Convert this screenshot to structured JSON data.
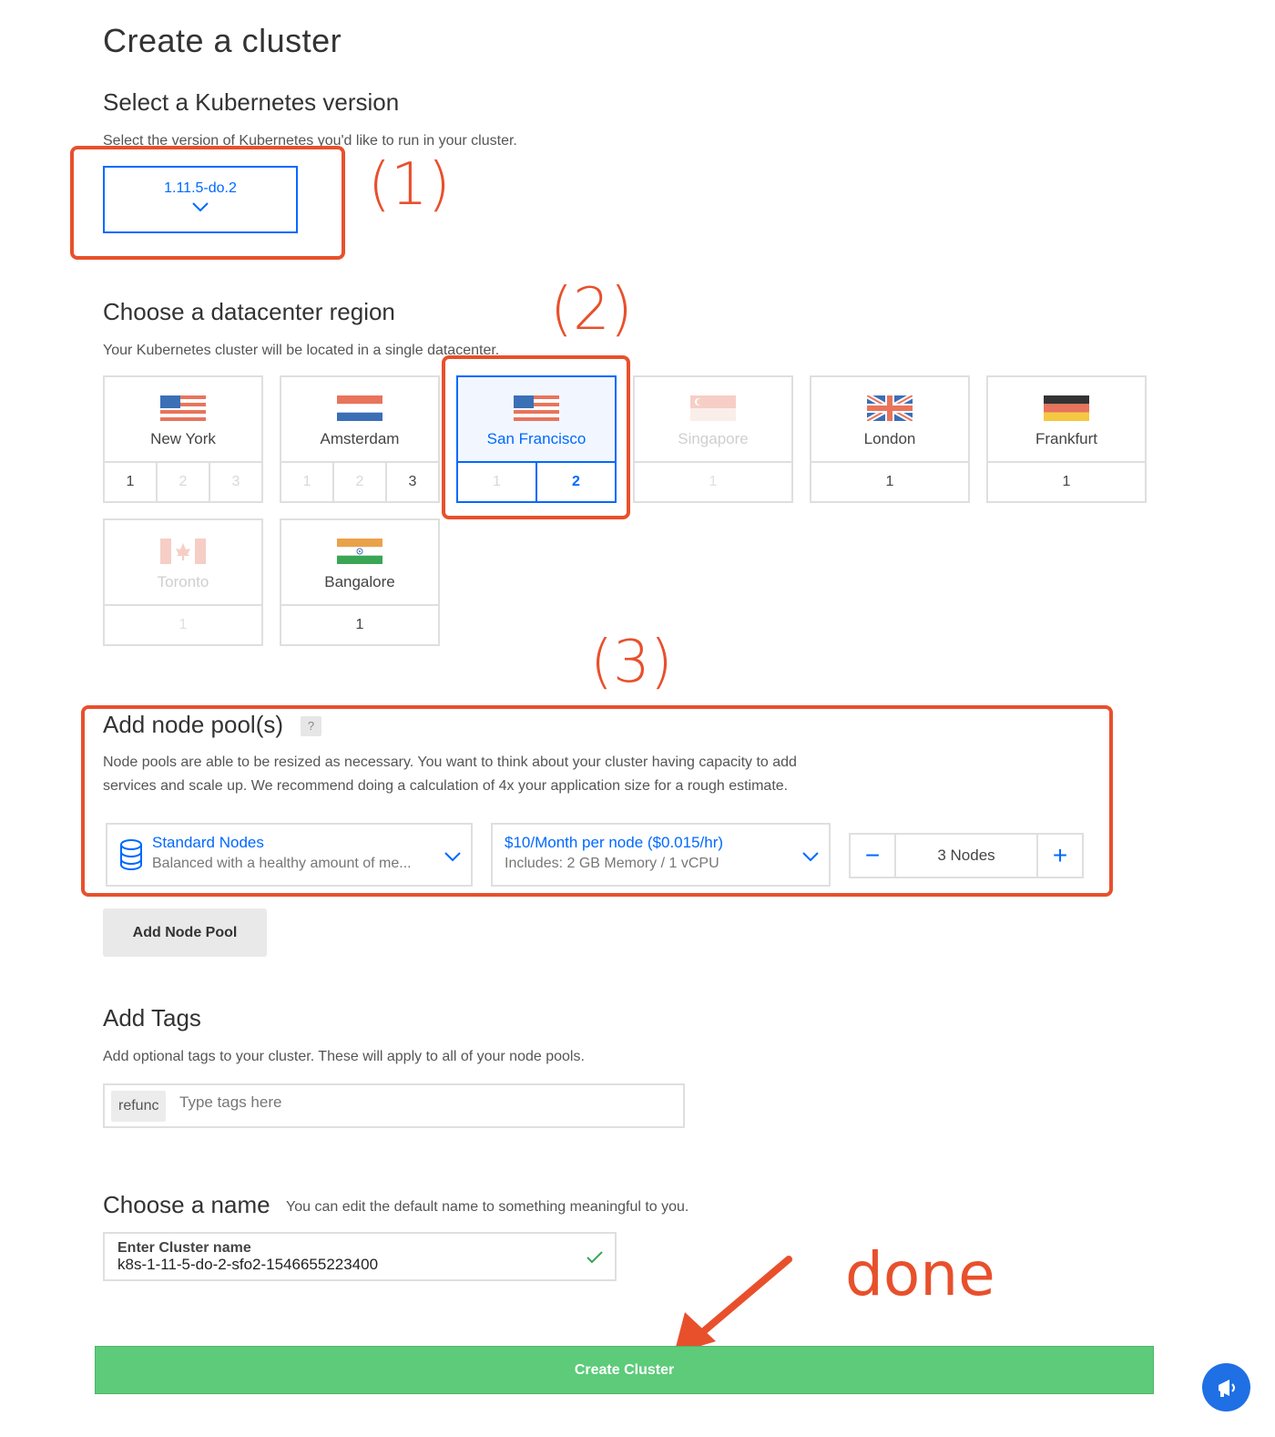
{
  "page_title": "Create a cluster",
  "version": {
    "heading": "Select a Kubernetes version",
    "description": "Select the version of Kubernetes you'd like to run in your cluster.",
    "selected": "1.11.5-do.2"
  },
  "annotations": {
    "one": "(1)",
    "two": "(2)",
    "three": "(3)",
    "done": "done"
  },
  "region": {
    "heading": "Choose a datacenter region",
    "description": "Your Kubernetes cluster will be located in a single datacenter.",
    "regions": [
      {
        "name": "New York",
        "numbers": [
          "1",
          "2",
          "3"
        ]
      },
      {
        "name": "Amsterdam",
        "numbers": [
          "1",
          "2",
          "3"
        ]
      },
      {
        "name": "San Francisco",
        "numbers": [
          "1",
          "2"
        ]
      },
      {
        "name": "Singapore",
        "numbers": [
          "1"
        ]
      },
      {
        "name": "London",
        "numbers": [
          "1"
        ]
      },
      {
        "name": "Frankfurt",
        "numbers": [
          "1"
        ]
      },
      {
        "name": "Toronto",
        "numbers": [
          "1"
        ]
      },
      {
        "name": "Bangalore",
        "numbers": [
          "1"
        ]
      }
    ]
  },
  "node_pool": {
    "heading": "Add node pool(s)",
    "help": "?",
    "description_line1": "Node pools are able to be resized as necessary. You want to think about your cluster having capacity to add",
    "description_line2": "services and scale up. We recommend doing a calculation of 4x your application size for a rough estimate.",
    "type_title": "Standard Nodes",
    "type_subtitle": "Balanced with a healthy amount of me...",
    "plan_title": "$10/Month per node ($0.015/hr)",
    "plan_subtitle": "Includes: 2 GB Memory / 1 vCPU",
    "count": "3",
    "count_unit": "Nodes",
    "minus": "−",
    "plus": "+",
    "add_button": "Add Node Pool"
  },
  "tags": {
    "heading": "Add Tags",
    "description": "Add optional tags to your cluster. These will apply to all of your node pools.",
    "chip": "refunc",
    "placeholder": "Type tags here"
  },
  "name": {
    "heading": "Choose a name",
    "hint": "You can edit the default name to something meaningful to you.",
    "label": "Enter Cluster name",
    "value": "k8s-1-11-5-do-2-sfo2-1546655223400"
  },
  "create_button": "Create Cluster",
  "colors": {
    "accent": "#0069ff",
    "annotation": "#e8502c",
    "create": "#5dcb7a"
  }
}
